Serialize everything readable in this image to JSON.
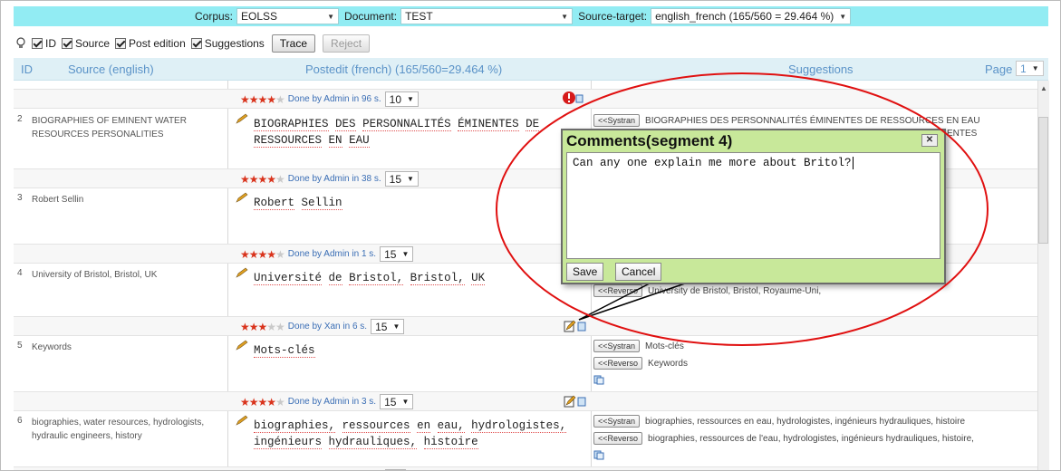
{
  "topbar": {
    "corpus_label": "Corpus:",
    "corpus_value": "EOLSS",
    "document_label": "Document:",
    "document_value": "TEST",
    "source_target_label": "Source-target:",
    "source_target_value": "english_french (165/560 = 29.464 %)"
  },
  "toolbar": {
    "cb_id": "ID",
    "cb_source": "Source",
    "cb_post_edition": "Post edition",
    "cb_suggestions": "Suggestions",
    "trace_label": "Trace",
    "reject_label": "Reject"
  },
  "header": {
    "id": "ID",
    "source": "Source (english)",
    "postedit": "Postedit (french) (165/560=29.464 %)",
    "suggestions": "Suggestions",
    "page_label": "Page",
    "page_value": "1"
  },
  "metas": [
    {
      "done": "Done by Admin in 96 s.",
      "score": "10",
      "stars": 4
    },
    {
      "done": "Done by Admin in 38 s.",
      "score": "15",
      "stars": 4
    },
    {
      "done": "Done by Admin in 1 s.",
      "score": "15",
      "stars": 4
    },
    {
      "done": "Done by Xan in 6 s.",
      "score": "15",
      "stars": 3
    },
    {
      "done": "Done by Admin in 3 s.",
      "score": "15",
      "stars": 4
    },
    {
      "done": "",
      "score": "15",
      "stars": 4
    }
  ],
  "segments": [
    {
      "id": "2",
      "source": "BIOGRAPHIES OF EMINENT WATER RESOURCES PERSONALITIES",
      "post": [
        "BIOGRAPHIES",
        "DES",
        "PERSONNALITÉS",
        "ÉMINENTES",
        "DE",
        "RESSOURCES",
        "EN",
        "EAU"
      ],
      "suggestions": [
        {
          "btn": "<<Systran",
          "text": "BIOGRAPHIES DES PERSONNALITÉS ÉMINENTES DE RESSOURCES EN EAU"
        },
        {
          "btn": "",
          "text": "ENTES"
        }
      ]
    },
    {
      "id": "3",
      "source": "Robert Sellin",
      "post": [
        "Robert",
        "Sellin"
      ],
      "suggestions": []
    },
    {
      "id": "4",
      "source": "University of Bristol, Bristol, UK",
      "post": [
        "Université",
        "de",
        "Bristol,",
        "Bristol,",
        "UK"
      ],
      "suggestions": [
        {
          "btn": "<<Reverso",
          "text": "University de Bristol, Bristol, Royaume-Uni,"
        }
      ]
    },
    {
      "id": "5",
      "source": "Keywords",
      "post": [
        "Mots-clés"
      ],
      "suggestions": [
        {
          "btn": "<<Systran",
          "text": "Mots-clés"
        },
        {
          "btn": "<<Reverso",
          "text": "Keywords"
        }
      ]
    },
    {
      "id": "6",
      "source": "biographies, water resources, hydrologists, hydraulic engineers, history",
      "post": [
        "biographies,",
        "ressources",
        "en",
        "eau,",
        "hydrologistes,",
        "ingénieurs",
        "hydrauliques,",
        "histoire"
      ],
      "suggestions": [
        {
          "btn": "<<Systran",
          "text": "biographies, ressources en eau, hydrologistes, ingénieurs hydrauliques, histoire"
        },
        {
          "btn": "<<Reverso",
          "text": "biographies, ressources de l'eau, hydrologistes, ingénieurs hydrauliques, histoire,"
        }
      ]
    }
  ],
  "popup": {
    "title": "Comments(segment 4)",
    "close": "✕",
    "comment": "Can any one explain me more about Britol?",
    "save_label": "Save",
    "cancel_label": "Cancel"
  },
  "colors": {
    "topbar": "#92ecf3",
    "header": "#dff0f6",
    "popup": "#c8e89a",
    "annotation": "#e01010",
    "stars": "#d9331c"
  }
}
